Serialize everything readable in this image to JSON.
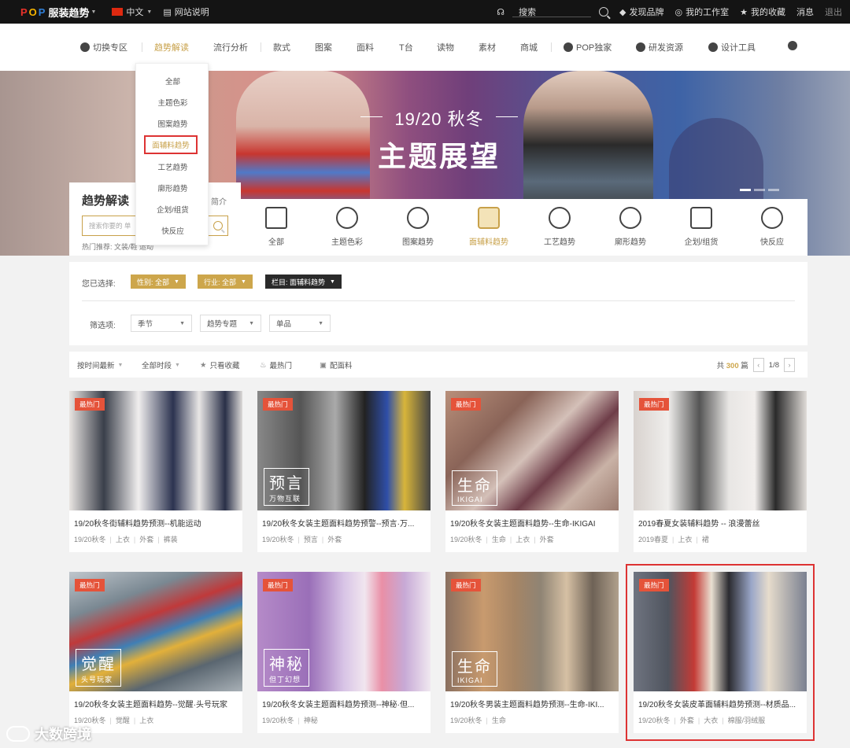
{
  "topbar": {
    "logo_pop": [
      "P",
      "O",
      "P"
    ],
    "brand": "服装趋势",
    "language": "中文",
    "guide": "网站说明",
    "search_label": "搜索",
    "discover": "发现品牌",
    "workspace": "我的工作室",
    "favorites": "我的收藏",
    "messages": "消息",
    "logout": "退出"
  },
  "nav": {
    "items": [
      "切换专区",
      "趋势解读",
      "流行分析",
      "款式",
      "图案",
      "面料",
      "T台",
      "读物",
      "素材",
      "商城",
      "POP独家",
      "研发资源",
      "设计工具"
    ]
  },
  "dropdown": {
    "items": [
      "全部",
      "主题色彩",
      "图案趋势",
      "面辅料趋势",
      "工艺趋势",
      "廓形趋势",
      "企划/组货",
      "快反应"
    ],
    "highlight_index": 3
  },
  "banner": {
    "subtitle": "19/20 秋冬",
    "title": "主题展望"
  },
  "search_panel": {
    "title": "趋势解读",
    "intro": "简介",
    "placeholder": "搜索你要的 单",
    "hot": "热门推荐: 文装/鞋 运动"
  },
  "categories": {
    "items": [
      "全部",
      "主题色彩",
      "图案趋势",
      "面辅料趋势",
      "工艺趋势",
      "廓形趋势",
      "企划/组货",
      "快反应"
    ],
    "active_index": 3
  },
  "filter": {
    "selected_label": "您已选择:",
    "chips": [
      "性别: 全部",
      "行业: 全部",
      "栏目: 面辅料趋势"
    ],
    "filter_label": "筛选项:",
    "selects": [
      "季节",
      "趋势专题",
      "单品"
    ]
  },
  "sortbar": {
    "sort_time": "按时间最新",
    "all_time": "全部时段",
    "only_fav": "只看收藏",
    "hottest": "最热门",
    "fabric": "配面料",
    "total_prefix": "共",
    "total": "300",
    "total_suffix": "篇",
    "page": "1/8"
  },
  "cards": [
    {
      "badge": "最热门",
      "title": "19/20秋冬街辅料趋势预测--机能运动",
      "tags": [
        "19/20秋冬",
        "上衣",
        "外套",
        "裤装"
      ],
      "overlay_big": "",
      "overlay_small": ""
    },
    {
      "badge": "最热门",
      "title": "19/20秋冬女装主题面料趋势预警--预言·万...",
      "tags": [
        "19/20秋冬",
        "预言",
        "外套"
      ],
      "overlay_big": "预言",
      "overlay_small": "万物互联"
    },
    {
      "badge": "最热门",
      "title": "19/20秋冬女装主题面料趋势--生命-IKIGAI",
      "tags": [
        "19/20秋冬",
        "生命",
        "上衣",
        "外套"
      ],
      "overlay_big": "生命",
      "overlay_small": "IKIGAI"
    },
    {
      "badge": "最热门",
      "title": "2019春夏女装辅料趋势 -- 浪漫蕾丝",
      "tags": [
        "2019春夏",
        "上衣",
        "裙"
      ],
      "overlay_big": "",
      "overlay_small": ""
    },
    {
      "badge": "最热门",
      "title": "19/20秋冬女装主题面料趋势--觉醒·头号玩家",
      "tags": [
        "19/20秋冬",
        "觉醒",
        "上衣"
      ],
      "overlay_big": "觉醒",
      "overlay_small": "头号玩家"
    },
    {
      "badge": "最热门",
      "title": "19/20秋冬女装主题面料趋势预测--神秘·但...",
      "tags": [
        "19/20秋冬",
        "神秘"
      ],
      "overlay_big": "神秘",
      "overlay_small": "但丁幻想"
    },
    {
      "badge": "最热门",
      "title": "19/20秋冬男装主题面料趋势预测--生命-IKI...",
      "tags": [
        "19/20秋冬",
        "生命"
      ],
      "overlay_big": "生命",
      "overlay_small": "IKIGAI"
    },
    {
      "badge": "最热门",
      "title": "19/20秋冬女装皮革面辅料趋势预测--材质品...",
      "tags": [
        "19/20秋冬",
        "外套",
        "大衣",
        "棉服/羽绒服"
      ],
      "overlay_big": "",
      "overlay_small": ""
    }
  ],
  "watermark": "大数跨境",
  "colors": {
    "gold": "#cda64b",
    "badge": "#e5533a",
    "highlight": "#dd3333"
  }
}
